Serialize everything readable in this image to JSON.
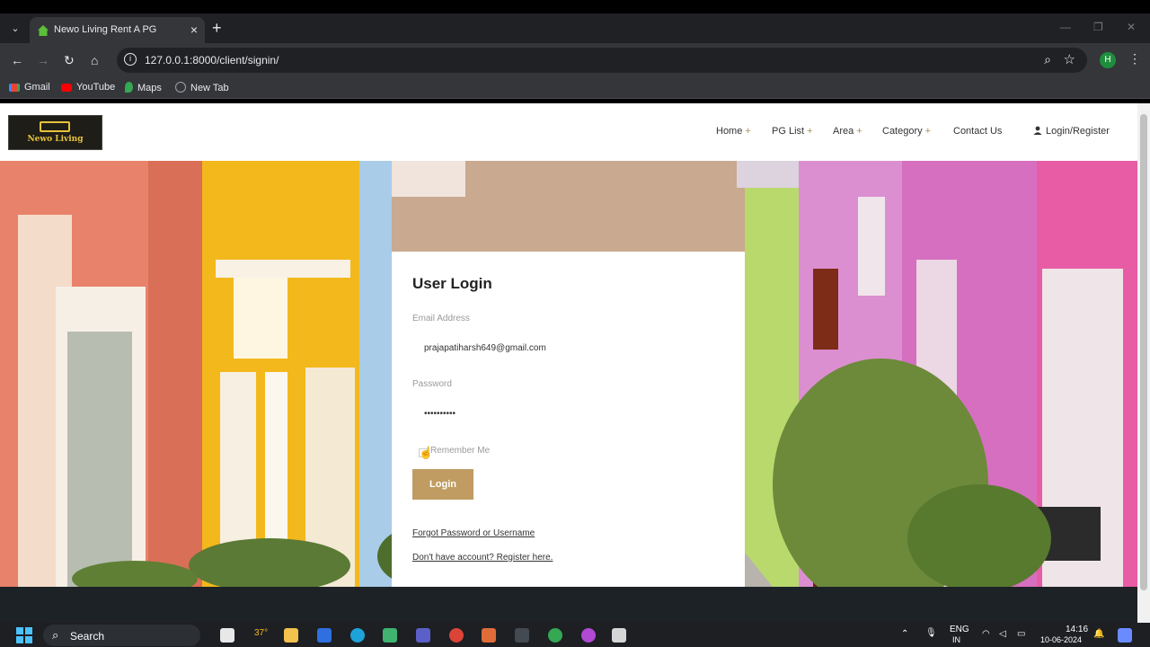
{
  "browser": {
    "tab_title": "Newo Living Rent A PG",
    "url": "127.0.0.1:8000/client/signin/",
    "profile_initial": "H",
    "bookmarks": [
      {
        "label": "Gmail",
        "icon": "gmail-icon",
        "color": "#ea4335"
      },
      {
        "label": "YouTube",
        "icon": "youtube-icon",
        "color": "#ff0000"
      },
      {
        "label": "Maps",
        "icon": "maps-icon",
        "color": "#34a853"
      },
      {
        "label": "New Tab",
        "icon": "globe-icon",
        "color": "#9aa0a6"
      }
    ]
  },
  "site": {
    "logo_text": "Newo Living",
    "nav": [
      {
        "label": "Home",
        "suffix": "+"
      },
      {
        "label": "PG List",
        "suffix": "+"
      },
      {
        "label": "Area",
        "suffix": "+"
      },
      {
        "label": "Category",
        "suffix": "+"
      },
      {
        "label": "Contact Us",
        "suffix": ""
      }
    ],
    "login_register": "Login/Register",
    "accent_color": "#c09c62"
  },
  "login": {
    "title": "User Login",
    "email_label": "Email Address",
    "email_value": "prajapatiharsh649@gmail.com",
    "password_label": "Password",
    "password_value": "••••••••••",
    "remember_label": "Remember Me",
    "button_label": "Login",
    "forgot_link": "Forgot Password or Username",
    "register_link": "Don't have account? Register here."
  },
  "taskbar": {
    "search_label": "Search",
    "weather": "37°",
    "language": "ENG",
    "language_sub": "IN",
    "time": "14:16",
    "date": "10-06-2024"
  }
}
